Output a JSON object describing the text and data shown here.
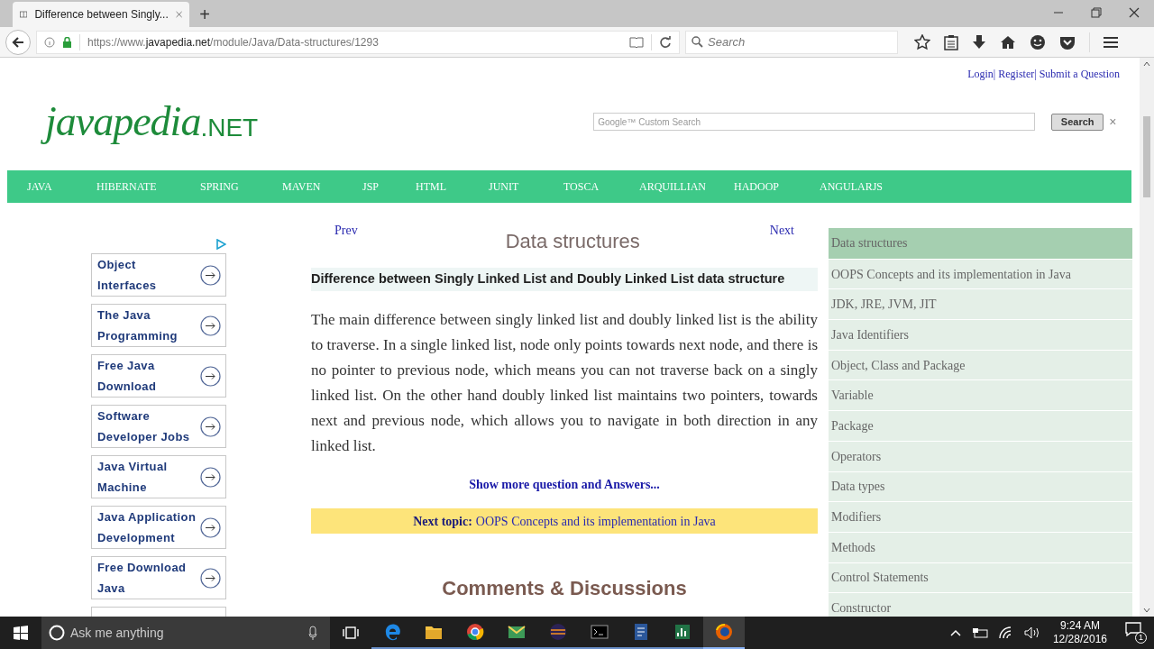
{
  "browser": {
    "tab_title": "Difference between Singly...",
    "new_tab": "+",
    "url": {
      "prefix": "https://www.",
      "domain": "javapedia.net",
      "path": "/module/Java/Data-structures/1293"
    },
    "search_placeholder": "Search"
  },
  "header": {
    "links": [
      "Login|",
      "Register|",
      "Submit a Question"
    ],
    "logo": {
      "main": "javapedia",
      "suffix": ".NET"
    },
    "search": {
      "placeholder": "Google™ Custom Search",
      "button": "Search",
      "clear": "×"
    }
  },
  "nav": [
    "JAVA",
    "HIBERNATE",
    "SPRING",
    "MAVEN",
    "JSP",
    "HTML",
    "JUNIT",
    "TOSCA",
    "ARQUILLIAN",
    "HADOOP",
    "ANGULARJS"
  ],
  "ads": [
    "Object Interfaces",
    "The Java Programming",
    "Free Java Download",
    "Software Developer Jobs",
    "Java Virtual Machine",
    "Java Application Development",
    "Free Download Java"
  ],
  "article": {
    "prev": "Prev",
    "next": "Next",
    "title": "Data structures",
    "question": "Difference between Singly Linked List and Doubly Linked List data structure",
    "answer": "The main difference between singly linked list and doubly linked list is the ability to traverse. In a single linked list, node only points towards next node, and there is no pointer to previous node, which means you can not traverse back on a singly linked list. On the other hand doubly linked list maintains two pointers, towards next and previous node, which allows you to navigate in both direction in any linked list.",
    "show_more": "Show more question and Answers...",
    "next_topic": {
      "label": "Next topic:",
      "link": "OOPS Concepts and its implementation in Java"
    },
    "comments_title": "Comments & Discussions"
  },
  "sidebar": [
    {
      "label": "Data structures",
      "selected": true
    },
    {
      "label": "OOPS Concepts and its implementation in Java",
      "selected": false
    },
    {
      "label": "JDK, JRE, JVM, JIT",
      "selected": false
    },
    {
      "label": "Java Identifiers",
      "selected": false
    },
    {
      "label": "Object, Class and Package",
      "selected": false
    },
    {
      "label": "Variable",
      "selected": false
    },
    {
      "label": "Package",
      "selected": false
    },
    {
      "label": "Operators",
      "selected": false
    },
    {
      "label": "Data types",
      "selected": false
    },
    {
      "label": "Modifiers",
      "selected": false
    },
    {
      "label": "Methods",
      "selected": false
    },
    {
      "label": "Control Statements",
      "selected": false
    },
    {
      "label": "Constructor",
      "selected": false
    }
  ],
  "taskbar": {
    "search_placeholder": "Ask me anything",
    "apps": [
      {
        "kind": "edge",
        "active": false
      },
      {
        "kind": "folder",
        "active": false
      },
      {
        "kind": "chrome",
        "active": false
      },
      {
        "kind": "mail",
        "active": false
      },
      {
        "kind": "eclipse",
        "active": false
      },
      {
        "kind": "terminal",
        "active": false
      },
      {
        "kind": "document",
        "active": false
      },
      {
        "kind": "chart",
        "active": false
      },
      {
        "kind": "firefox",
        "active": true
      }
    ],
    "time": "9:24 AM",
    "date": "12/28/2016",
    "notifications": "1"
  }
}
